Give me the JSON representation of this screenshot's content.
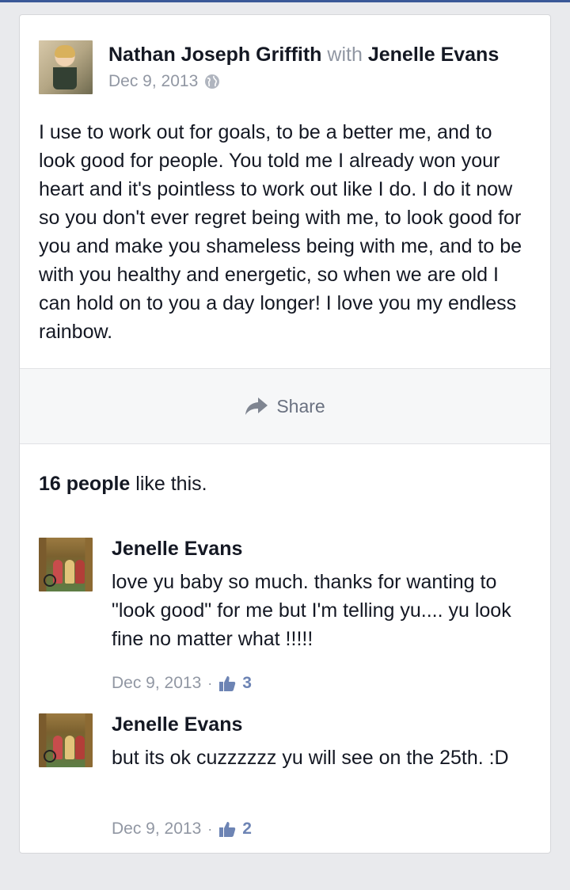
{
  "post": {
    "author": "Nathan Joseph Griffith",
    "with_word": "with",
    "tagged": "Jenelle Evans",
    "date": "Dec 9, 2013",
    "privacy_icon": "globe-icon",
    "body": "I use to work out for goals, to be a better me, and to look good for people. You told me I already won your heart and it's pointless to work out like I do. I do it now so you don't ever regret being with me, to look good for you and make you shameless being with me, and to be with you healthy and energetic, so when we are old I can hold on to you a day longer! I love you my endless rainbow."
  },
  "share": {
    "label": "Share",
    "icon": "share-arrow-icon"
  },
  "likes": {
    "count_text": "16 people",
    "suffix": "like this."
  },
  "comments": [
    {
      "name": "Jenelle Evans",
      "text": "love yu baby so much. thanks for wanting to \"look good\" for me but I'm telling yu.... yu look fine no matter what !!!!!",
      "date": "Dec 9, 2013",
      "separator": "·",
      "likes": "3"
    },
    {
      "name": "Jenelle Evans",
      "text": "but its ok cuzzzzzz yu will see on the 25th. :D",
      "date": "Dec 9, 2013",
      "separator": "·",
      "likes": "2"
    }
  ],
  "colors": {
    "brand": "#3b5998",
    "meta": "#9197a3",
    "like_count": "#6d84b4"
  }
}
